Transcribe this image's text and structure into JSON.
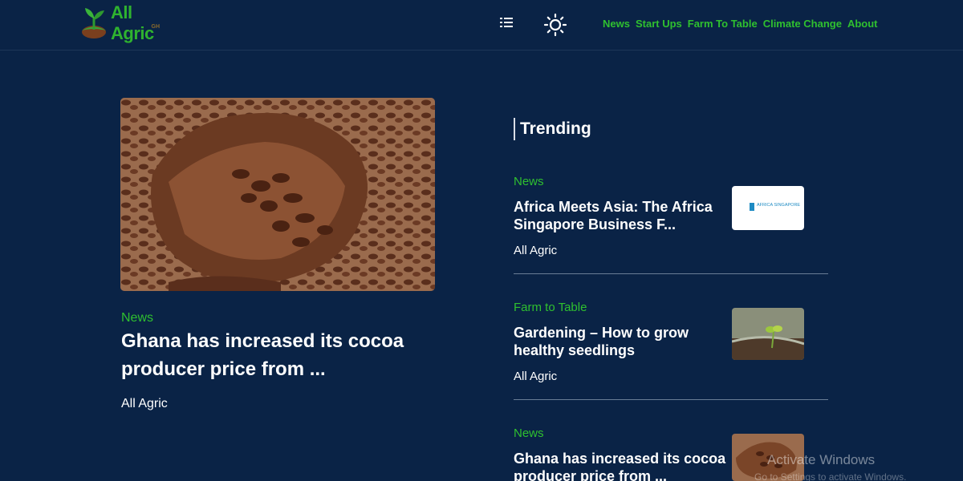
{
  "header": {
    "logo": {
      "name": "All Agric",
      "sub": "GH"
    },
    "nav": [
      "News",
      "Start Ups",
      "Farm To Table",
      "Climate Change",
      "About"
    ]
  },
  "featured": {
    "category": "News",
    "title": "Ghana has increased its cocoa producer price from ...",
    "author": "All Agric"
  },
  "trending": {
    "heading": "Trending",
    "items": [
      {
        "category": "News",
        "title": "Africa Meets Asia: The Africa Singapore Business F...",
        "author": "All Agric",
        "thumb_text": "AFRICA SINGAPORE"
      },
      {
        "category": "Farm to Table",
        "title": "Gardening – How to grow healthy seedlings",
        "author": "All Agric"
      },
      {
        "category": "News",
        "title": "Ghana has increased its cocoa producer price from ..."
      }
    ]
  },
  "watermark": {
    "title": "Activate Windows",
    "subtitle": "Go to Settings to activate Windows."
  },
  "colors": {
    "background": "#0a2346",
    "accent": "#2fc02f"
  }
}
